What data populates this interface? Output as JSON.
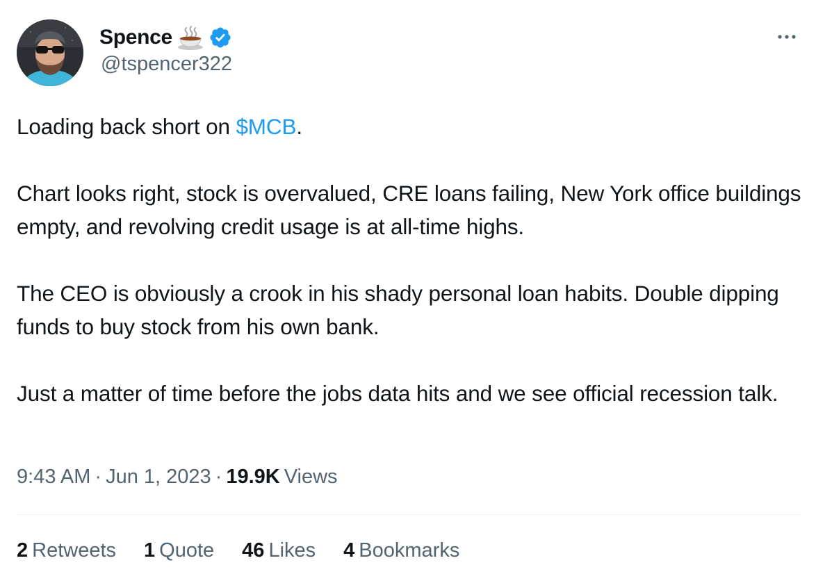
{
  "author": {
    "display_name": "Spence",
    "name_emoji": "hot-beverage-emoji",
    "verified_badge": "verified-badge-icon",
    "handle": "@tspencer322",
    "avatar": "avatar-photo"
  },
  "more_menu_icon": "more-horizontal-icon",
  "tweet": {
    "line1_before": "Loading back short on ",
    "cashtag": "$MCB",
    "line1_after": ".",
    "paragraph2": "Chart looks right, stock is overvalued, CRE loans failing, New York office buildings empty, and revolving credit usage is at all-time highs.",
    "paragraph3": "The CEO is obviously a crook in his shady personal loan habits. Double dipping funds to buy stock from his own bank.",
    "paragraph4": "Just a matter of time before the jobs data hits and we see official recession talk."
  },
  "meta": {
    "time": "9:43 AM",
    "separator": "·",
    "date": "Jun 1, 2023",
    "views_count": "19.9K",
    "views_label": "Views"
  },
  "stats": [
    {
      "count": "2",
      "label": "Retweets"
    },
    {
      "count": "1",
      "label": "Quote"
    },
    {
      "count": "46",
      "label": "Likes"
    },
    {
      "count": "4",
      "label": "Bookmarks"
    }
  ],
  "colors": {
    "link": "#1d9bf0",
    "secondary_text": "#536471",
    "primary_text": "#0f1419",
    "divider": "#eff3f4",
    "verified": "#1d9bf0"
  }
}
